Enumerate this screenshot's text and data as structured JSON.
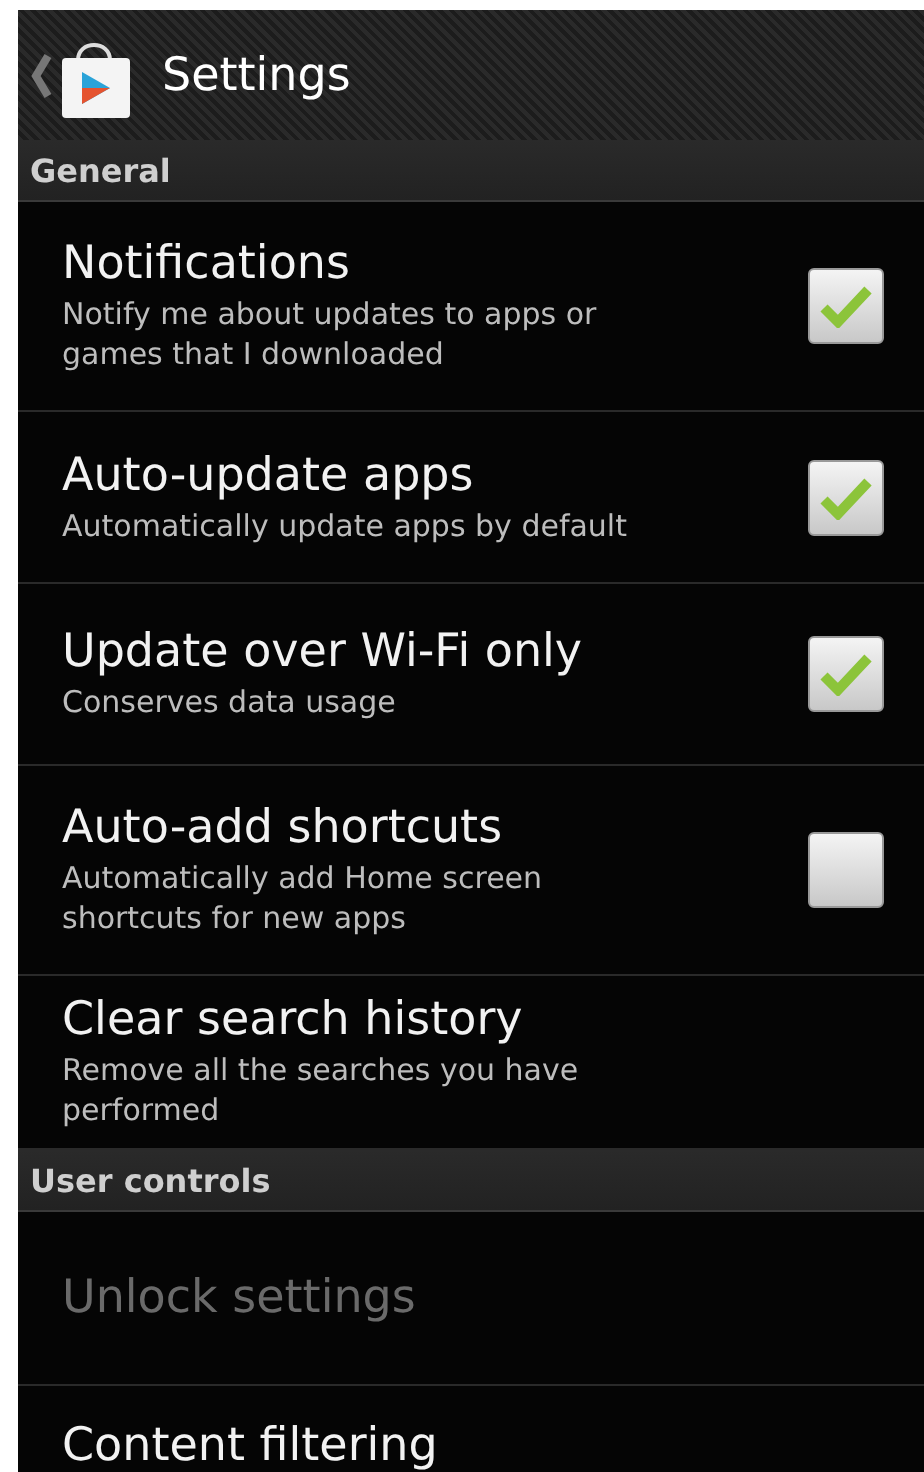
{
  "action_bar": {
    "title": "Settings"
  },
  "sections": [
    {
      "header": "General",
      "items": [
        {
          "kind": "checkbox",
          "title": "Notifications",
          "summary": "Notify me about updates to apps or games that I downloaded",
          "checked": true,
          "disabled": false
        },
        {
          "kind": "checkbox",
          "title": "Auto-update apps",
          "summary": "Automatically update apps by default",
          "checked": true,
          "disabled": false
        },
        {
          "kind": "checkbox",
          "title": "Update over Wi-Fi only",
          "summary": "Conserves data usage",
          "checked": true,
          "disabled": false
        },
        {
          "kind": "checkbox",
          "title": "Auto-add shortcuts",
          "summary": "Automatically add Home screen shortcuts for new apps",
          "checked": false,
          "disabled": false
        },
        {
          "kind": "plain",
          "title": "Clear search history",
          "summary": "Remove all the searches you have performed",
          "disabled": false
        }
      ]
    },
    {
      "header": "User controls",
      "items": [
        {
          "kind": "plain",
          "title": "Unlock settings",
          "disabled": true
        },
        {
          "kind": "plain",
          "title": "Content filtering",
          "disabled": false
        }
      ]
    }
  ]
}
